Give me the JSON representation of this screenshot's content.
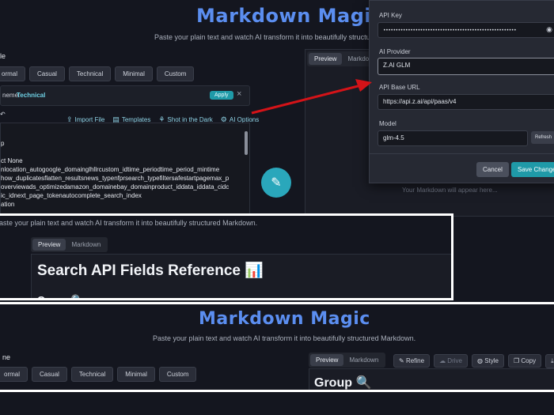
{
  "app": {
    "title": "Markdown Magic",
    "subtitle": "Paste your plain text and watch AI transform it into beautifully structured Markdown."
  },
  "top": {
    "subtitle_partial": "Paste your plain text and watch AI transform it into beautifully structured M",
    "style_label": "le",
    "styles": [
      "ormal",
      "Casual",
      "Technical",
      "Minimal",
      "Custom"
    ],
    "theme_prefix": "neme:",
    "theme_value": "Technical",
    "apply_label": "Apply",
    "close_glyph": "×",
    "tools": [
      {
        "icon": "⇪",
        "label": "Import File"
      },
      {
        "icon": "▤",
        "label": "Templates"
      },
      {
        "icon": "⚘",
        "label": "Shot in the Dark"
      },
      {
        "icon": "⚙",
        "label": "AI Options"
      }
    ],
    "editor_lines": [
      "p",
      "",
      "ct None",
      "nlocation_autogoogle_domainglhllrcustom_idtime_periodtime_period_mintime",
      "how_duplicatesflatten_resultsnews_typenfprsearch_typefiltersafestartpagemax_p",
      "overviewads_optimizedamazon_domainebay_domainproduct_iddata_iddata_cidc",
      "ic_idnext_page_tokenautocomplete_search_index",
      "ation"
    ],
    "preview_tabs": [
      "Preview",
      "Markdown"
    ],
    "placeholder": "Your Markdown will appear here..."
  },
  "settings": {
    "api_key_label": "API Key",
    "api_key_value": "••••••••••••••••••••••••••••••••••••••••••••••••••••••",
    "provider_label": "AI Provider",
    "provider_value": "Z.AI GLM",
    "base_url_label": "API Base URL",
    "base_url_value": "https://api.z.ai/api/paas/v4",
    "model_label": "Model",
    "model_value": "glm-4.5",
    "refresh_label": "Refresh",
    "cancel_label": "Cancel",
    "save_label": "Save Changes"
  },
  "middle": {
    "subtitle_partial": "aste your plain text and watch AI transform it into beautifully structured Markdown.",
    "tabs": [
      "Preview",
      "Markdown"
    ],
    "heading": "Search API Fields Reference 📊",
    "subheading": "Group 🔍"
  },
  "bottom": {
    "title": "Markdown Magic",
    "subtitle": "Paste your plain text and watch AI transform it into beautifully structured Markdown.",
    "style_label": "ne",
    "styles": [
      "ormal",
      "Casual",
      "Technical",
      "Minimal",
      "Custom"
    ],
    "tabs": [
      "Preview",
      "Markdown"
    ],
    "actions": [
      {
        "icon": "✎",
        "label": "Refine"
      },
      {
        "icon": "☁",
        "label": "Drive"
      },
      {
        "icon": "◍",
        "label": "Style"
      },
      {
        "icon": "❐",
        "label": "Copy"
      },
      {
        "icon": "⤓",
        "label": "Ex"
      }
    ],
    "group_heading": "Group 🔍"
  },
  "colors": {
    "accent": "#5b8ef0",
    "teal": "#2aa7bb",
    "arrow": "#d41318",
    "apply": "#1f9aa8"
  }
}
